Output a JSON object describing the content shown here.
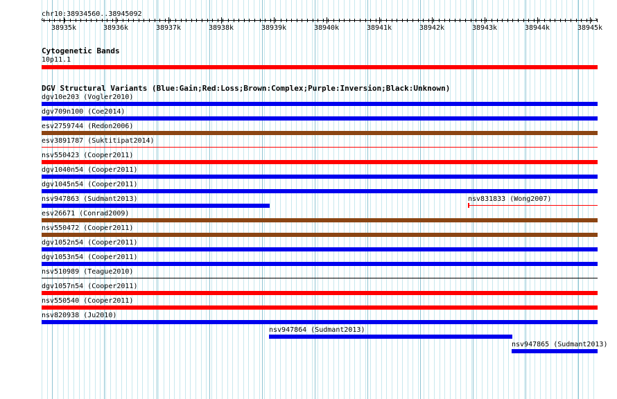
{
  "location": "chr10:38934560..38945092",
  "ruler": {
    "ticks": [
      "38935k",
      "38936k",
      "38937k",
      "38938k",
      "38939k",
      "38940k",
      "38941k",
      "38942k",
      "38943k",
      "38944k",
      "38945k"
    ]
  },
  "cytobands": {
    "title": "Cytogenetic Bands",
    "band_label": "10p11.1",
    "band_color": "#ff0000"
  },
  "dgv": {
    "title": "DGV Structural Variants (Blue:Gain;Red:Loss;Brown:Complex;Purple:Inversion;Black:Unknown)",
    "colors": {
      "blue": "#0000ee",
      "red": "#ff0000",
      "brown": "#8b4513",
      "black": "#000000"
    },
    "features": [
      {
        "label": "dgv10e203 (Vogler2010)",
        "color": "blue",
        "style": "thick"
      },
      {
        "label": "dgv709n100 (Coe2014)",
        "color": "blue",
        "style": "thick"
      },
      {
        "label": "esv2759744 (Redon2006)",
        "color": "brown",
        "style": "thick"
      },
      {
        "label": "esv3891787 (Suktitipat2014)",
        "color": "red",
        "style": "thin"
      },
      {
        "label": "nsv550423 (Cooper2011)",
        "color": "red",
        "style": "thick"
      },
      {
        "label": "dgv1040n54 (Cooper2011)",
        "color": "blue",
        "style": "thick"
      },
      {
        "label": "dgv1045n54 (Cooper2011)",
        "color": "blue",
        "style": "thick"
      },
      {
        "label": "nsv947863 (Sudmant2013)",
        "color": "blue",
        "style": "thick"
      },
      {
        "label": "nsv831833 (Wong2007)",
        "color": "red",
        "style": "thin"
      },
      {
        "label": "esv26671 (Conrad2009)",
        "color": "brown",
        "style": "thick"
      },
      {
        "label": "nsv550472 (Cooper2011)",
        "color": "brown",
        "style": "thick"
      },
      {
        "label": "dgv1052n54 (Cooper2011)",
        "color": "blue",
        "style": "thick"
      },
      {
        "label": "dgv1053n54 (Cooper2011)",
        "color": "blue",
        "style": "thick"
      },
      {
        "label": "nsv510989 (Teague2010)",
        "color": "black",
        "style": "thin"
      },
      {
        "label": "dgv1057n54 (Cooper2011)",
        "color": "red",
        "style": "thick"
      },
      {
        "label": "nsv550540 (Cooper2011)",
        "color": "red",
        "style": "thick"
      },
      {
        "label": "nsv820938 (Ju2010)",
        "color": "blue",
        "style": "thick"
      },
      {
        "label": "nsv947864 (Sudmant2013)",
        "color": "blue",
        "style": "thick"
      },
      {
        "label": "nsv947865 (Sudmant2013)",
        "color": "blue",
        "style": "thick"
      }
    ]
  }
}
